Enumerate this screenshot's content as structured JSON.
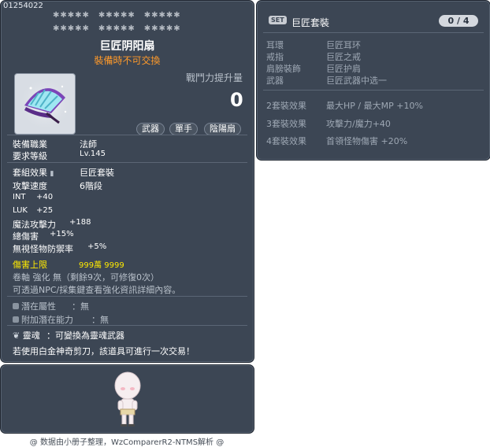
{
  "item": {
    "id": "01254022",
    "name": "巨匠阴阳扇",
    "trade_notice": "裝備時不可交換",
    "combat_power_label": "戰鬥力提升量",
    "combat_power_value": "0",
    "tags": [
      "武器",
      "單手",
      "陰陽扇"
    ],
    "req_job_label": "裝備職業",
    "req_job_value": "法師",
    "req_level_label": "要求等級",
    "req_level_value": "Lv.145",
    "set_effect_label": "套組效果",
    "set_effect_value": "巨匠套裝",
    "attack_speed_label": "攻擊速度",
    "attack_speed_value": "6階段",
    "stats": [
      {
        "label": "INT",
        "value": "+40"
      },
      {
        "label": "LUK",
        "value": "+25"
      },
      {
        "label": "魔法攻擊力",
        "value": "+188"
      },
      {
        "label": "總傷害",
        "value": "+15%"
      },
      {
        "label": "無視怪物防禦率",
        "value": "+5%"
      }
    ],
    "damage_cap_label": "傷害上限",
    "damage_cap_value": "999萬 9999",
    "scroll_text": "卷軸 強化 無（剩餘9次，可修復0次）",
    "npc_text": "可透過NPC/採集鍵查看強化資訊詳細內容。",
    "potential_label": "潛在屬性",
    "potential_value": "：無",
    "add_potential_label": "附加潛在能力",
    "add_potential_value": "：無",
    "soul_label": "靈魂",
    "soul_value": "：可變換為靈魂武器",
    "trade_text": "若使用白金神奇剪刀，該道具可進行一次交易！"
  },
  "set": {
    "badge": "SET",
    "name": "巨匠套裝",
    "counter": "0 / 4",
    "pieces": [
      {
        "slot": "耳環",
        "name": "巨匠耳环"
      },
      {
        "slot": "戒指",
        "name": "巨匠之戒"
      },
      {
        "slot": "肩膀裝飾",
        "name": "巨匠护肩"
      },
      {
        "slot": "武器",
        "name": "巨匠武器中选一"
      }
    ],
    "effects": [
      {
        "label": "2套裝效果",
        "value": "最大HP / 最大MP  +10%"
      },
      {
        "label": "3套裝效果",
        "value": "攻擊力/魔力+40"
      },
      {
        "label": "4套裝效果",
        "value": "首領怪物傷害  +20%"
      }
    ]
  },
  "credits": "@ 数据由小册子整理，WzComparerR2-NTMS解析 @"
}
